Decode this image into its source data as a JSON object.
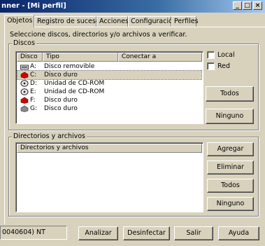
{
  "window": {
    "title": "nner - [Mi perfil]",
    "buttons": {
      "minimize": "_",
      "maximize": "□",
      "close": "×"
    }
  },
  "tabs": [
    {
      "label": "Objetos",
      "active": true
    },
    {
      "label": "Registro de sucesos",
      "active": false
    },
    {
      "label": "Acciones",
      "active": false
    },
    {
      "label": "Configuración",
      "active": false
    },
    {
      "label": "Perfiles",
      "active": false
    }
  ],
  "instruction": "Seleccione discos, directorios y/o archivos a verificar.",
  "disks_group": {
    "title": "Discos",
    "columns": [
      "Disco",
      "Tipo",
      "Conectar a"
    ],
    "rows": [
      {
        "letter": "A:",
        "type": "Disco removible",
        "icon": "floppy-drive-icon",
        "selected": false
      },
      {
        "letter": "C:",
        "type": "Disco duro",
        "icon": "hard-disk-icon",
        "selected": true
      },
      {
        "letter": "D:",
        "type": "Unidad de CD-ROM",
        "icon": "cdrom-drive-icon",
        "selected": false
      },
      {
        "letter": "E:",
        "type": "Unidad de CD-ROM",
        "icon": "cdrom-drive-icon",
        "selected": false
      },
      {
        "letter": "F:",
        "type": "Disco duro",
        "icon": "hard-disk-icon",
        "selected": false
      },
      {
        "letter": "G:",
        "type": "Disco duro",
        "icon": "hard-disk-icon",
        "selected": false
      }
    ],
    "checkboxes": [
      {
        "label": "Local",
        "checked": false
      },
      {
        "label": "Red",
        "checked": false
      }
    ],
    "buttons": {
      "all": "Todos",
      "none": "Ninguno"
    }
  },
  "dirs_group": {
    "title": "Directorios y archivos",
    "column": "Directorios y archivos",
    "buttons": {
      "add": "Agregar",
      "remove": "Eliminar",
      "all": "Todos",
      "none": "Ninguno"
    }
  },
  "footer": {
    "status": "0040604) NT",
    "buttons": {
      "analyze": "Analizar",
      "disinfect": "Desinfectar",
      "exit": "Salir",
      "help": "Ayuda"
    }
  },
  "colors": {
    "title_bar": "#0a246a",
    "face": "#d8d2bd",
    "hard_disk_red": "#d40000"
  }
}
